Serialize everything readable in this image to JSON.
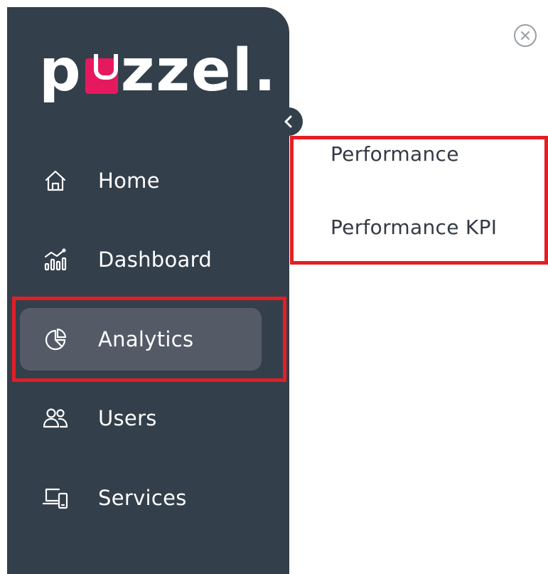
{
  "brand": {
    "logo_text_left": "p",
    "logo_text_right": "zzel.",
    "accent_color": "#e6195f",
    "sidebar_color": "#333f4b"
  },
  "sidebar": {
    "collapse_icon": "chevron-left-icon",
    "items": [
      {
        "label": "Home",
        "icon": "home-icon"
      },
      {
        "label": "Dashboard",
        "icon": "dashboard-icon"
      },
      {
        "label": "Analytics",
        "icon": "pie-chart-icon",
        "active": true
      },
      {
        "label": "Users",
        "icon": "users-icon"
      },
      {
        "label": "Services",
        "icon": "devices-icon"
      }
    ]
  },
  "submenu": {
    "items": [
      {
        "label": "Performance"
      },
      {
        "label": "Performance KPI"
      }
    ],
    "close_icon": "close-circle-icon"
  },
  "highlight_color": "#e31e24"
}
